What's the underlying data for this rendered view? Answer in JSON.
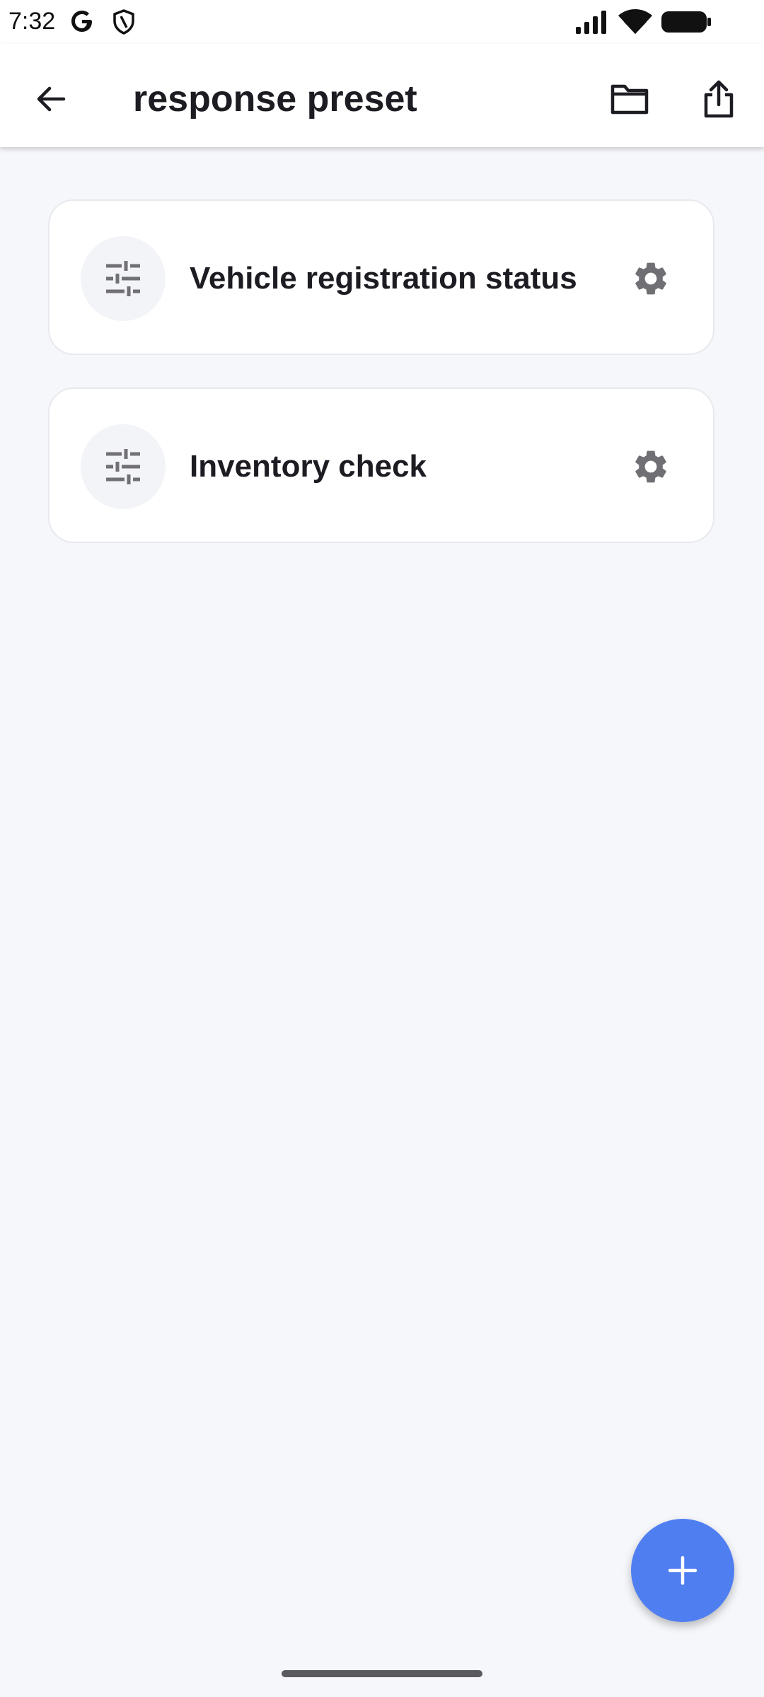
{
  "status_bar": {
    "time": "7:32",
    "icons": [
      "google-icon",
      "shield-icon",
      "signal-icon",
      "wifi-icon",
      "battery-icon"
    ]
  },
  "app_bar": {
    "title": "response preset",
    "back_icon": "arrow-left-icon",
    "folder_icon": "folder-icon",
    "share_icon": "share-icon"
  },
  "presets": [
    {
      "label": "Vehicle registration status",
      "icon": "sliders-icon",
      "action_icon": "gear-icon"
    },
    {
      "label": "Inventory check",
      "icon": "sliders-icon",
      "action_icon": "gear-icon"
    }
  ],
  "fab": {
    "icon": "plus-icon"
  },
  "colors": {
    "background": "#f6f7fb",
    "card": "#ffffff",
    "accent": "#4f7ef1",
    "icon_gray": "#6f6f74",
    "text": "#1c1c22"
  }
}
